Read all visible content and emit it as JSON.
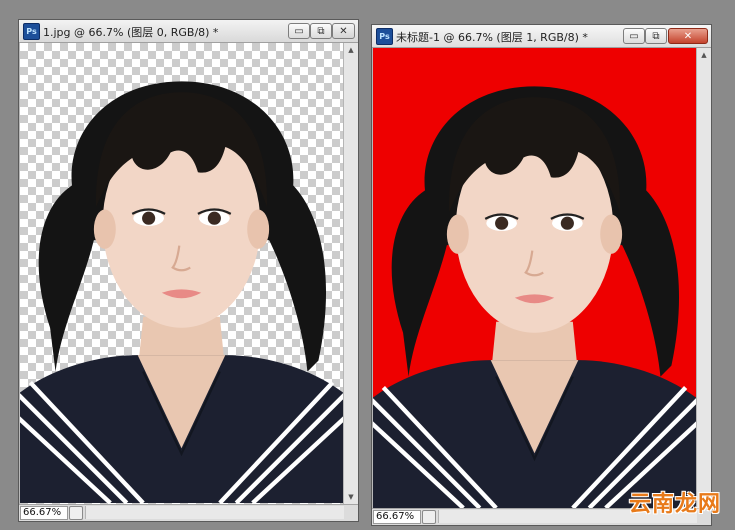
{
  "windows": [
    {
      "title": "1.jpg @ 66.7% (图层 0, RGB/8) *",
      "background": "transparent-checkerboard",
      "zoom": "66.67%",
      "app_icon": "Ps"
    },
    {
      "title": "未标题-1 @ 66.7% (图层 1, RGB/8) *",
      "background": "#ee0000",
      "zoom": "66.67%",
      "app_icon": "Ps"
    }
  ],
  "window_buttons": {
    "minimize": "▭",
    "restore": "⧉",
    "close": "✕"
  },
  "watermark": "云南龙网",
  "colors": {
    "red_background": "#ee0000",
    "workspace": "#8a8a8a",
    "watermark": "#e87a1a"
  }
}
